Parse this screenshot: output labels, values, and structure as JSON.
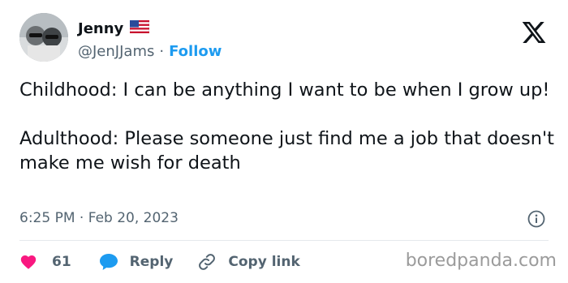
{
  "author": {
    "name": "Jenny",
    "flag_icon": "us-flag-icon",
    "handle": "@JenJJams",
    "separator": "·",
    "follow_label": "Follow"
  },
  "tweet": {
    "paragraphs": [
      "Childhood: I can be anything I want to be when I grow up!",
      "Adulthood: Please someone just find me a job that doesn't make me wish for death"
    ],
    "time": "6:25 PM",
    "separator": "·",
    "date": "Feb 20, 2023"
  },
  "actions": {
    "likes_count": "61",
    "reply_label": "Reply",
    "copy_link_label": "Copy link"
  },
  "watermark": "boredpanda.com",
  "colors": {
    "link_blue": "#1d9bf0",
    "like_red": "#f91880",
    "text": "#0f1419",
    "muted": "#536471"
  }
}
